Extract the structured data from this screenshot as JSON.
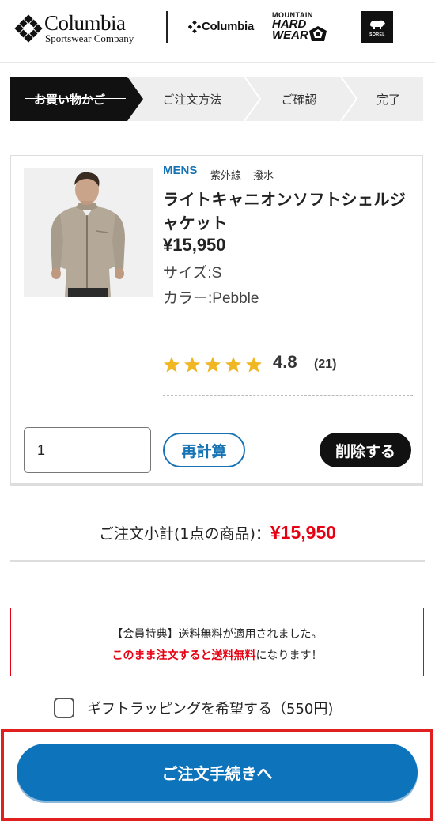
{
  "header": {
    "brand_main": "Columbia",
    "brand_main_sub": "Sportswear Company",
    "brand_columbia": "Columbia",
    "brand_mhw_top": "MOUNTAIN",
    "brand_mhw_mid": "HARD",
    "brand_mhw_bottom": "WEAR",
    "brand_sorel": "SOREL"
  },
  "steps": [
    {
      "label": "お買い物かご",
      "active": true
    },
    {
      "label": "ご注文方法",
      "active": false
    },
    {
      "label": "ご確認",
      "active": false
    },
    {
      "label": "完了",
      "active": false
    }
  ],
  "product": {
    "category": "MENS",
    "tags": [
      "紫外線",
      "撥水"
    ],
    "name": "ライトキャニオンソフトシェルジャケット",
    "price": "¥15,950",
    "size": "サイズ:S",
    "color": "カラー:Pebble",
    "rating": "4.8",
    "rating_count": "(21)",
    "stars": 5,
    "quantity": "1",
    "recalc_label": "再計算",
    "delete_label": "削除する"
  },
  "subtotal": {
    "label": "ご注文小計(1点の商品)：",
    "amount": "¥15,950"
  },
  "notice": {
    "line1": "【会員特典】送料無料が適用されました。",
    "line2_red": "このまま注文すると送料無料",
    "line2_rest": "になります！"
  },
  "gift": {
    "label": "ギフトラッピングを希望する（550円)",
    "checked": false
  },
  "cta": {
    "label": "ご注文手続きへ"
  },
  "colors": {
    "accent": "#0d73bb",
    "price_red": "#e60012",
    "star": "#f0b722",
    "highlight_frame": "#e0201e"
  }
}
